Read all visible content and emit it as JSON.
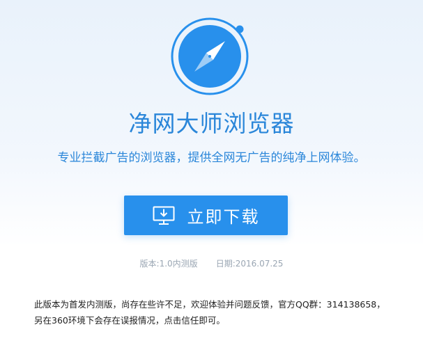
{
  "app": {
    "title": "净网大师浏览器",
    "tagline": "专业拦截广告的浏览器，提供全网无广告的纯净上网体验。"
  },
  "download": {
    "label": "立即下载",
    "icon": "monitor-download-icon"
  },
  "meta": {
    "version": "版本:1.0内测版",
    "date": "日期:2016.07.25"
  },
  "notice": {
    "line1": "此版本为首发内测版，尚存在些许不足，欢迎体验并问题反馈，官方QQ群：314138658，",
    "line2": "另在360环境下会存在误报情况，点击信任即可。"
  },
  "logo": {
    "icon": "compass-icon"
  },
  "colors": {
    "brand": "#2890ec",
    "title_text": "#2a86d9",
    "meta_text": "#9aa6b3",
    "body_text": "#222222",
    "needle": "#ffffff"
  }
}
